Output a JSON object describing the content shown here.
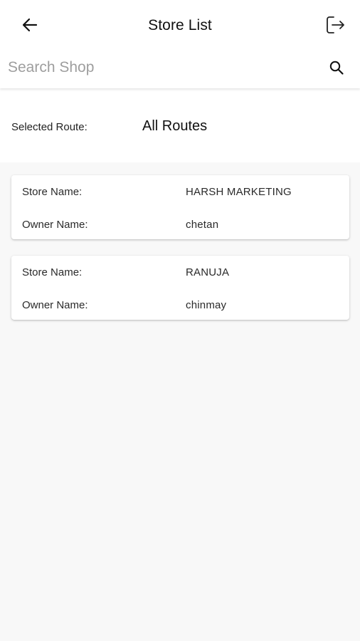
{
  "header": {
    "title": "Store List",
    "back_icon": "arrow-left-icon",
    "logout_icon": "logout-icon"
  },
  "search": {
    "value": "",
    "placeholder": "Search Shop",
    "icon": "search-icon"
  },
  "route": {
    "label": "Selected Route:",
    "value": "All Routes"
  },
  "stores": [
    {
      "store_label": "Store Name:",
      "store_name": "HARSH MARKETING",
      "owner_label": "Owner Name:",
      "owner_name": "chetan"
    },
    {
      "store_label": "Store Name:",
      "store_name": "RANUJA",
      "owner_label": "Owner Name:",
      "owner_name": "chinmay"
    }
  ],
  "colors": {
    "background": "#f8f8f8",
    "surface": "#ffffff",
    "placeholder": "#9e9e9e",
    "text": "#1b1b1b"
  }
}
